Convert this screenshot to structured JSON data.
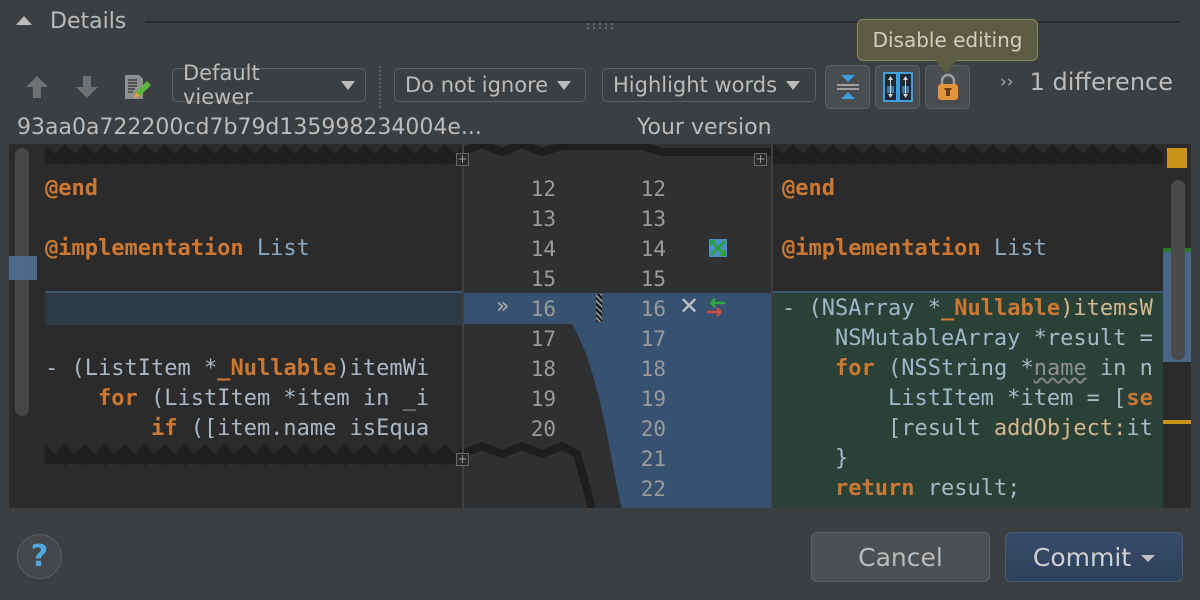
{
  "header": {
    "title": "Details"
  },
  "toolbar": {
    "viewer_combo": "Default viewer",
    "ignore_combo": "Do not ignore",
    "highlight_combo": "Highlight words",
    "tooltip": "Disable editing",
    "difference_count": "1 difference",
    "icons": {
      "prev": "arrow-up-icon",
      "next": "arrow-down-icon",
      "edit": "edit-source-icon",
      "collapse": "collapse-unchanged-icon",
      "sync_scroll": "synchronize-scrolling-icon",
      "lock": "lock-icon"
    }
  },
  "left": {
    "title": "93aa0a722200cd7b79d135998234004e...",
    "lines": [
      [
        {
          "t": "@end",
          "c": "kw"
        }
      ],
      [],
      [
        {
          "t": "@implementation",
          "c": "kw"
        },
        {
          "t": " List",
          "c": "cls"
        }
      ],
      [],
      [],
      [],
      [
        {
          "t": "- (",
          "c": "tx"
        },
        {
          "t": "ListItem",
          "c": "tx"
        },
        {
          "t": " *",
          "c": "tx"
        },
        {
          "t": "_Nullable",
          "c": "kw"
        },
        {
          "t": ")itemWi",
          "c": "tx"
        }
      ],
      [
        {
          "t": "    ",
          "c": "tx"
        },
        {
          "t": "for",
          "c": "kw"
        },
        {
          "t": " (ListItem *item in _i",
          "c": "tx"
        }
      ],
      [
        {
          "t": "        ",
          "c": "tx"
        },
        {
          "t": "if",
          "c": "kw"
        },
        {
          "t": " ([item.name isEqua",
          "c": "tx"
        }
      ]
    ],
    "line_numbers": [
      "12",
      "13",
      "14",
      "15",
      "16",
      "17",
      "18",
      "19",
      "20"
    ]
  },
  "right": {
    "title": "Your version",
    "lines": [
      [
        {
          "t": "@end",
          "c": "kw"
        }
      ],
      [],
      [
        {
          "t": "@implementation",
          "c": "kw"
        },
        {
          "t": " List",
          "c": "cls"
        }
      ],
      [],
      [
        {
          "t": "- (",
          "c": "tx"
        },
        {
          "t": "NSArray",
          "c": "ty"
        },
        {
          "t": " *",
          "c": "tx"
        },
        {
          "t": "_Nullable",
          "c": "kw"
        },
        {
          "t": ")itemsW",
          "c": "mt"
        }
      ],
      [
        {
          "t": "    ",
          "c": "tx"
        },
        {
          "t": "NSMutableArray",
          "c": "ty"
        },
        {
          "t": " *result =",
          "c": "tx"
        }
      ],
      [
        {
          "t": "    ",
          "c": "tx"
        },
        {
          "t": "for",
          "c": "kw"
        },
        {
          "t": " (",
          "c": "tx"
        },
        {
          "t": "NSString",
          "c": "ty"
        },
        {
          "t": " *",
          "c": "tx"
        },
        {
          "t": "name",
          "c": "wavy"
        },
        {
          "t": " in n",
          "c": "tx"
        }
      ],
      [
        {
          "t": "        ",
          "c": "tx"
        },
        {
          "t": "ListItem",
          "c": "ty"
        },
        {
          "t": " *item = [",
          "c": "tx"
        },
        {
          "t": "se",
          "c": "kw"
        }
      ],
      [
        {
          "t": "        [result ",
          "c": "tx"
        },
        {
          "t": "addObject:",
          "c": "mt"
        },
        {
          "t": "it",
          "c": "tx"
        }
      ],
      [
        {
          "t": "    }",
          "c": "tx"
        }
      ],
      [
        {
          "t": "    ",
          "c": "tx"
        },
        {
          "t": "return",
          "c": "kw"
        },
        {
          "t": " result;",
          "c": "tx"
        }
      ]
    ],
    "line_numbers": [
      "12",
      "13",
      "14",
      "15",
      "16",
      "17",
      "18",
      "19",
      "20",
      "21",
      "22"
    ]
  },
  "footer": {
    "help": "?",
    "cancel": "Cancel",
    "commit": "Commit"
  },
  "colors": {
    "background": "#3c3f41",
    "editor": "#2b2b2b",
    "keyword": "#cc7832",
    "changed_band": "#375270",
    "inserted_bg": "#294136",
    "accent_blue": "#4ea6dc",
    "stripe_yellow": "#c9931a"
  }
}
